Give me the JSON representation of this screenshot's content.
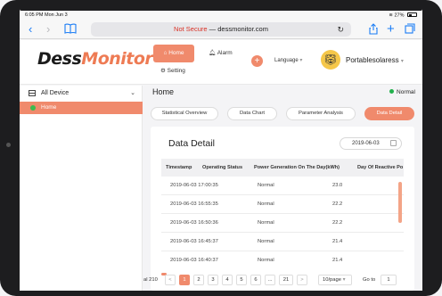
{
  "statusbar": {
    "time": "6:05 PM  Mon Jun 3",
    "battery": "27%"
  },
  "browser": {
    "not_secure": "Not Secure",
    "separator": " — ",
    "domain": "dessmonitor.com"
  },
  "app": {
    "logo_prefix": "Dess",
    "logo_suffix": "Monitor",
    "nav": {
      "home": "Home",
      "alarm": "Alarm",
      "setting": "Setting"
    },
    "language": "Language",
    "username": "Portablesolaress"
  },
  "sidebar": {
    "group_label": "All Device",
    "items": [
      {
        "label": "Home"
      }
    ]
  },
  "main": {
    "title": "Home",
    "status": "Normal",
    "tabs": [
      {
        "label": "Statistical Overview"
      },
      {
        "label": "Data Chart"
      },
      {
        "label": "Parameter Analysis"
      },
      {
        "label": "Data Detail"
      }
    ],
    "card_title": "Data Detail",
    "date_value": "2019-06-03",
    "table": {
      "headers": [
        "Timestamp",
        "Operating Status",
        "Power Generation On The Day(kWh)",
        "Day Of Reactive Po"
      ],
      "rows": [
        {
          "timestamp": "2019-06-03 17:00:35",
          "status": "Normal",
          "power": "23.0"
        },
        {
          "timestamp": "2019-06-03 16:55:35",
          "status": "Normal",
          "power": "22.2"
        },
        {
          "timestamp": "2019-06-03 16:50:36",
          "status": "Normal",
          "power": "22.2"
        },
        {
          "timestamp": "2019-06-03 16:45:37",
          "status": "Normal",
          "power": "21.4"
        },
        {
          "timestamp": "2019-06-03 16:40:37",
          "status": "Normal",
          "power": "21.4"
        }
      ]
    },
    "pager": {
      "total": "al 210",
      "prev": "<",
      "pages": [
        "1",
        "2",
        "3",
        "4",
        "5",
        "6",
        "...",
        "21"
      ],
      "next": ">",
      "page_size": "10/page",
      "goto_label": "Go to",
      "goto_value": "1"
    }
  },
  "colors": {
    "accent": "#f08a6c",
    "online": "#22b14c",
    "not_secure": "#d93025",
    "link": "#1a7cf5"
  }
}
